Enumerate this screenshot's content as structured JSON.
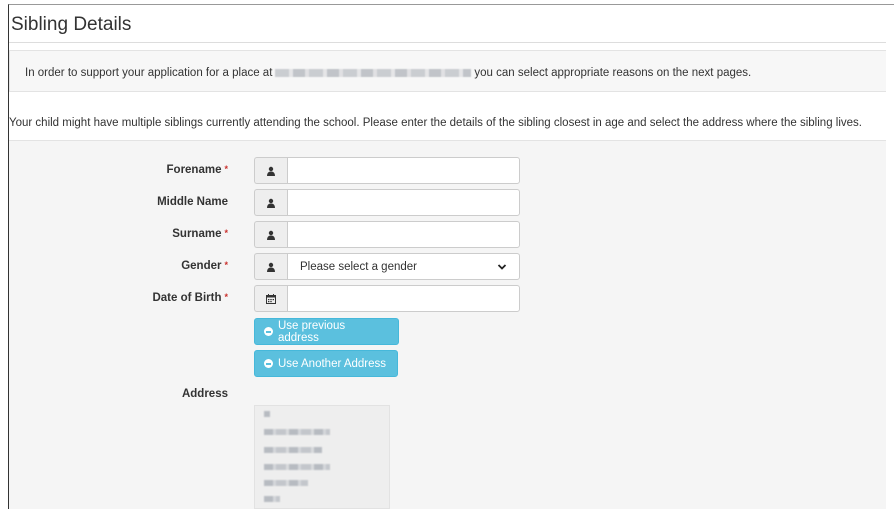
{
  "page": {
    "title": "Sibling Details",
    "info_text_prefix": "In order to support your application for a place at",
    "info_text_suffix": "you can select appropriate reasons on the next pages.",
    "description": "Your child might have multiple siblings currently attending the school. Please enter the details of the sibling closest in age and select the address where the sibling lives."
  },
  "form": {
    "forename_label": "Forename",
    "middle_name_label": "Middle Name",
    "surname_label": "Surname",
    "gender_label": "Gender",
    "gender_placeholder": "Please select a gender",
    "dob_label": "Date of Birth",
    "required_marker": "*",
    "forename_value": "",
    "middle_name_value": "",
    "surname_value": "",
    "dob_value": "",
    "use_previous_address_label": "Use previous address",
    "use_another_address_label": "Use Another Address",
    "address_label": "Address"
  },
  "icons": {
    "person": "user-icon",
    "calendar": "calendar-icon",
    "chevron": "chevron-down-icon",
    "minus": "minus-circle-icon"
  },
  "colors": {
    "info_button": "#5bc0de",
    "required": "#c9302c",
    "panel": "#f5f5f5"
  }
}
